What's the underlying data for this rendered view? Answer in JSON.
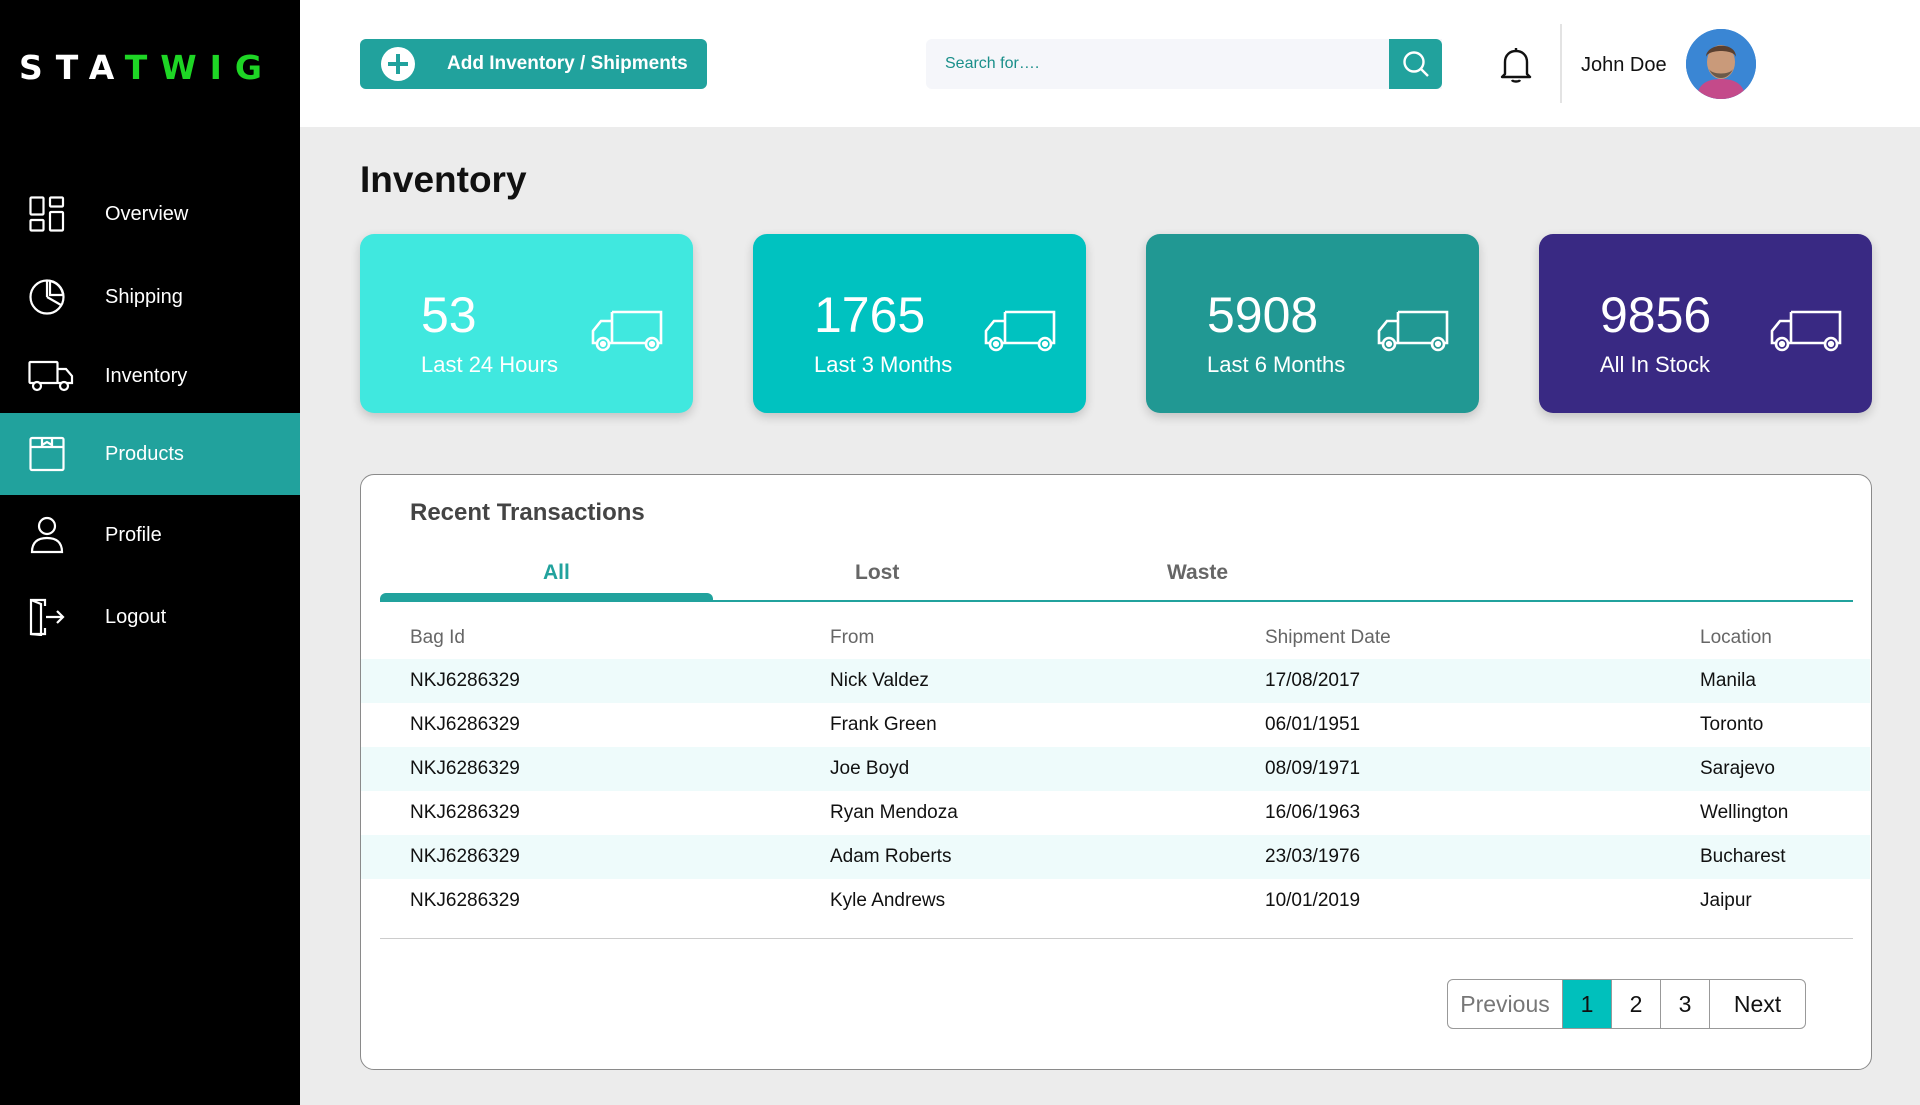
{
  "brand": {
    "part1": "STA",
    "part2": "TWIG"
  },
  "sidebar": {
    "items": [
      {
        "label": "Overview",
        "icon": "grid-icon"
      },
      {
        "label": "Shipping",
        "icon": "pie-chart-icon"
      },
      {
        "label": "Inventory",
        "icon": "truck-icon"
      },
      {
        "label": "Products",
        "icon": "box-icon",
        "active": true
      },
      {
        "label": "Profile",
        "icon": "user-icon"
      },
      {
        "label": "Logout",
        "icon": "logout-icon"
      }
    ]
  },
  "header": {
    "add_button_label": "Add Inventory / Shipments",
    "search_placeholder": "Search for….",
    "user_name": "John Doe"
  },
  "page_title": "Inventory",
  "cards": [
    {
      "value": "53",
      "label": "Last 24 Hours",
      "color": "#40e8df"
    },
    {
      "value": "1765",
      "label": "Last 3 Months",
      "color": "#00c2c0"
    },
    {
      "value": "5908",
      "label": "Last 6 Months",
      "color": "#219893"
    },
    {
      "value": "9856",
      "label": "All In Stock",
      "color": "#392983"
    }
  ],
  "transactions": {
    "title": "Recent Transactions",
    "tabs": [
      "All",
      "Lost",
      "Waste"
    ],
    "active_tab": "All",
    "columns": [
      "Bag Id",
      "From",
      "Shipment Date",
      "Location"
    ],
    "rows": [
      [
        "NKJ6286329",
        "Nick Valdez",
        "17/08/2017",
        "Manila"
      ],
      [
        "NKJ6286329",
        "Frank Green",
        "06/01/1951",
        "Toronto"
      ],
      [
        "NKJ6286329",
        "Joe Boyd",
        "08/09/1971",
        "Sarajevo"
      ],
      [
        "NKJ6286329",
        "Ryan Mendoza",
        "16/06/1963",
        "Wellington"
      ],
      [
        "NKJ6286329",
        "Adam Roberts",
        "23/03/1976",
        "Bucharest"
      ],
      [
        "NKJ6286329",
        "Kyle Andrews",
        "10/01/2019",
        "Jaipur"
      ]
    ]
  },
  "pagination": {
    "previous": "Previous",
    "pages": [
      "1",
      "2",
      "3"
    ],
    "current": "1",
    "next": "Next"
  },
  "colors": {
    "accent": "#21a29d",
    "brand_green": "#1ed625",
    "sidebar_bg": "#000000"
  }
}
